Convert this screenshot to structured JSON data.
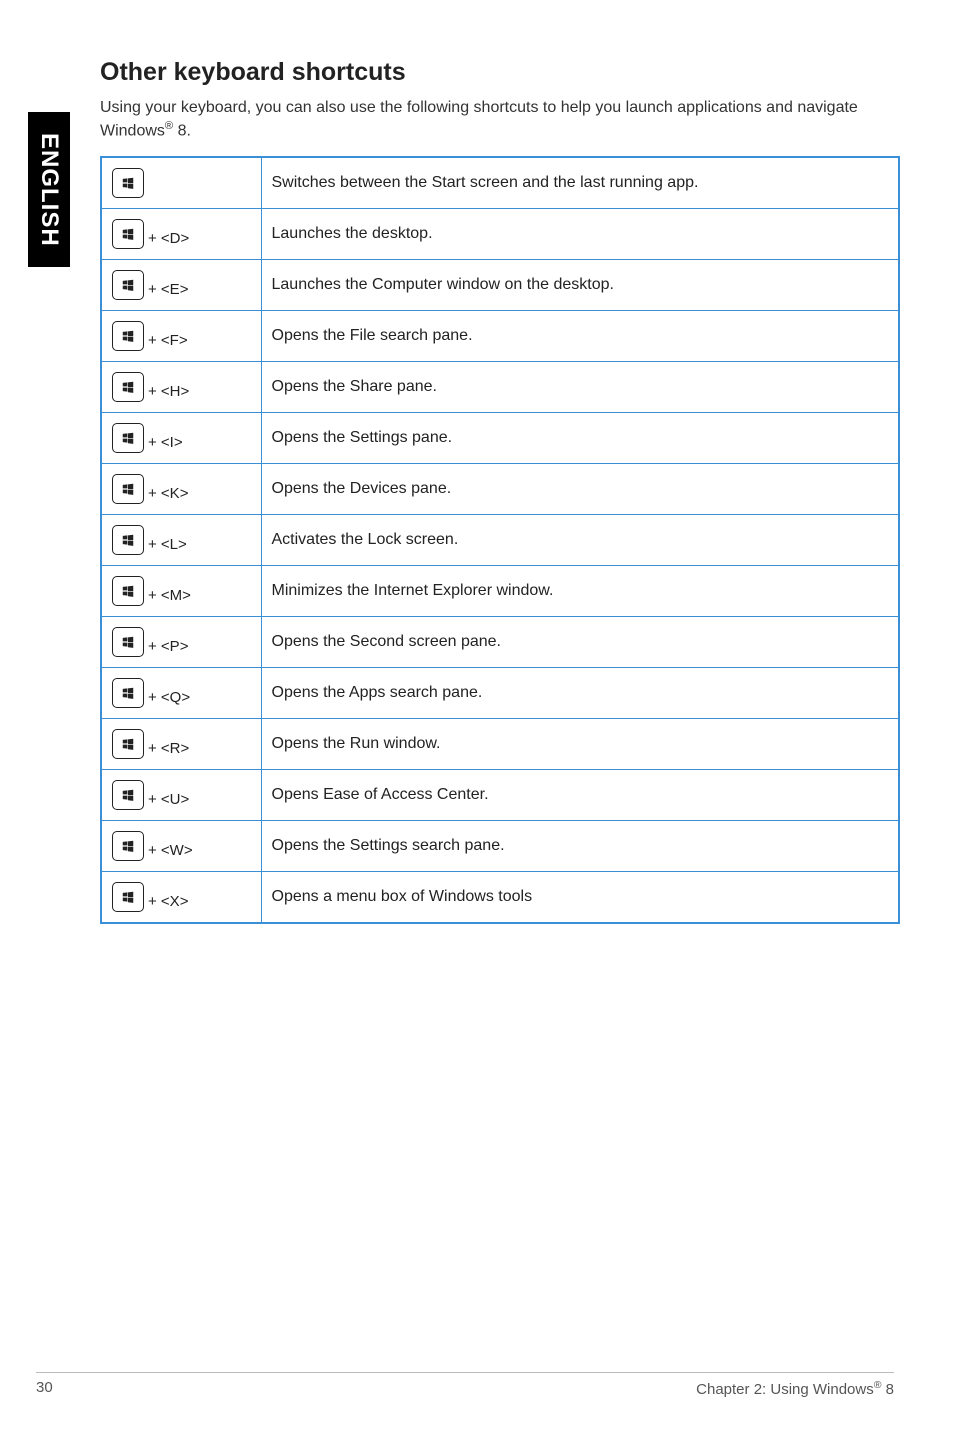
{
  "side_tab": "ENGLISH",
  "title": "Other keyboard shortcuts",
  "intro_a": "Using your keyboard, you can also use the following shortcuts to help you launch applications and navigate Windows",
  "intro_b": " 8.",
  "shortcuts": [
    {
      "combo": "",
      "desc": "Switches between the Start screen and the last running app."
    },
    {
      "combo": " + <D>",
      "desc": "Launches the desktop."
    },
    {
      "combo": " + <E>",
      "desc": "Launches the Computer window on the desktop."
    },
    {
      "combo": " + <F>",
      "desc": "Opens the File search pane."
    },
    {
      "combo": " + <H>",
      "desc": "Opens the Share pane."
    },
    {
      "combo": " + <I>",
      "desc": "Opens the Settings pane."
    },
    {
      "combo": " + <K>",
      "desc": "Opens the Devices pane."
    },
    {
      "combo": " + <L>",
      "desc": "Activates the Lock screen."
    },
    {
      "combo": " + <M>",
      "desc": "Minimizes the Internet Explorer window."
    },
    {
      "combo": " + <P>",
      "desc": "Opens the Second screen pane."
    },
    {
      "combo": " + <Q>",
      "desc": "Opens the Apps search pane."
    },
    {
      "combo": " + <R>",
      "desc": "Opens the Run window."
    },
    {
      "combo": " + <U>",
      "desc": "Opens Ease of Access Center."
    },
    {
      "combo": " + <W>",
      "desc": "Opens the Settings search pane."
    },
    {
      "combo": " + <X>",
      "desc": "Opens a menu box of Windows tools"
    }
  ],
  "footer": {
    "page_num": "30",
    "chapter_a": "Chapter 2: Using Windows",
    "chapter_b": " 8"
  }
}
